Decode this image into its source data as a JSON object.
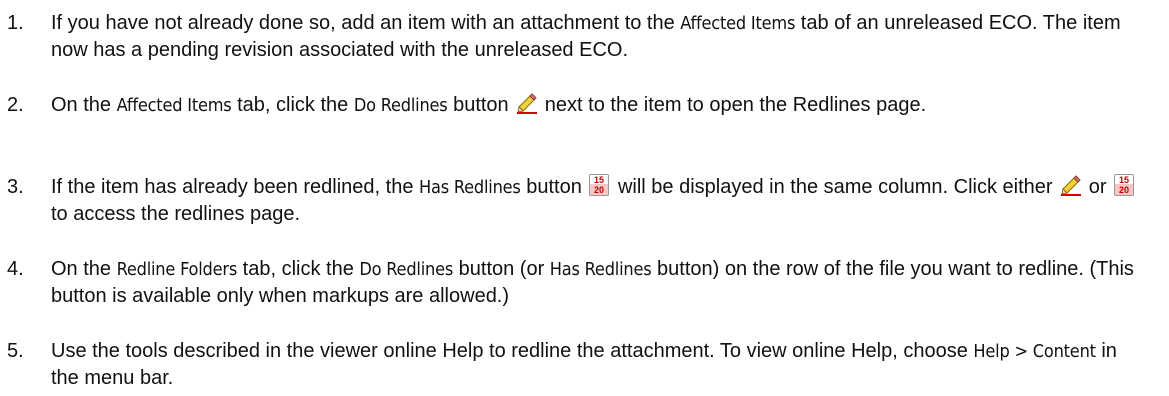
{
  "steps": [
    {
      "num": "1.",
      "parts": [
        {
          "t": "If you have not already done so, add an item with an attachment to the "
        },
        {
          "t": "Affected Items",
          "ui": true
        },
        {
          "t": " tab of an unreleased ECO. The item now has a pending revision associated with the unreleased ECO."
        }
      ]
    },
    {
      "num": "2.",
      "parts": [
        {
          "t": "On the "
        },
        {
          "t": "Affected Items",
          "ui": true
        },
        {
          "t": " tab, click the "
        },
        {
          "t": "Do Redlines",
          "ui": true
        },
        {
          "t": " button "
        },
        {
          "icon": "pencil-icon"
        },
        {
          "t": " next to the item to open the Redlines page."
        }
      ]
    },
    {
      "num": "3.",
      "parts": [
        {
          "t": "If the item has already been redlined, the "
        },
        {
          "t": "Has Redlines",
          "ui": true
        },
        {
          "t": " button "
        },
        {
          "icon": "calendar-icon"
        },
        {
          "t": " will be displayed in the same column. Click either "
        },
        {
          "icon": "pencil-icon"
        },
        {
          "t": " or "
        },
        {
          "icon": "calendar-icon"
        },
        {
          "t": " to access the redlines page."
        }
      ]
    },
    {
      "num": "4.",
      "parts": [
        {
          "t": "On the "
        },
        {
          "t": "Redline Folders",
          "ui": true
        },
        {
          "t": " tab, click the "
        },
        {
          "t": "Do Redlines",
          "ui": true
        },
        {
          "t": " button (or "
        },
        {
          "t": "Has Redlines",
          "ui": true
        },
        {
          "t": " button) on the row of the file you want to redline. (This button is available only when markups are allowed.)"
        }
      ]
    },
    {
      "num": "5.",
      "parts": [
        {
          "t": "Use the tools described in the viewer online Help to redline the attachment. To view online Help, choose "
        },
        {
          "t": "Help > Content",
          "ui": true
        },
        {
          "t": " in the menu bar."
        }
      ]
    }
  ],
  "icon_glyphs": {
    "calendar_top": "15",
    "calendar_bottom": "20"
  }
}
